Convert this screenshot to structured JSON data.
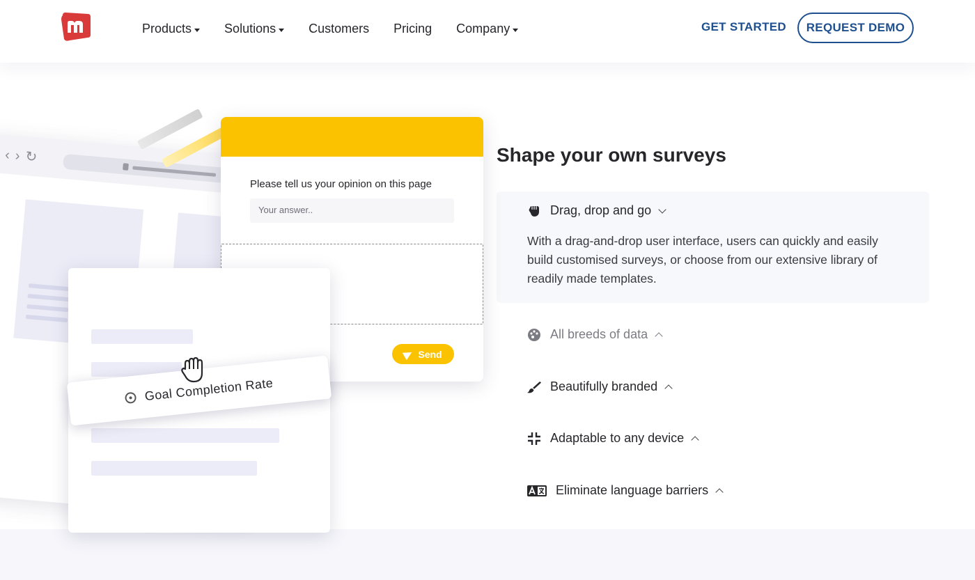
{
  "header": {
    "logo_icon": "m-logo-icon",
    "nav": [
      {
        "label": "Products",
        "has_dropdown": true
      },
      {
        "label": "Solutions",
        "has_dropdown": true
      },
      {
        "label": "Customers",
        "has_dropdown": false
      },
      {
        "label": "Pricing",
        "has_dropdown": false
      },
      {
        "label": "Company",
        "has_dropdown": true
      }
    ],
    "get_started": "GET STARTED",
    "request_demo": "REQUEST DEMO"
  },
  "illustration": {
    "survey_question": "Please tell us your opinion on this page",
    "survey_placeholder": "Your answer..",
    "send_label": "Send",
    "goal_label": "Goal Completion Rate"
  },
  "features": {
    "headline": "Shape your own surveys",
    "items": [
      {
        "label": "Drag, drop and go",
        "icon": "fist-icon",
        "expanded": true,
        "description": "With a drag-and-drop user interface, users can quickly and easily build customised surveys, or choose from our extensive library of readily made templates."
      },
      {
        "label": "All breeds of data",
        "icon": "palette-icon",
        "expanded": false
      },
      {
        "label": "Beautifully branded",
        "icon": "brush-icon",
        "expanded": false
      },
      {
        "label": "Adaptable to any device",
        "icon": "compress-icon",
        "expanded": false
      },
      {
        "label": "Eliminate language barriers",
        "icon": "translate-icon",
        "expanded": false
      }
    ]
  },
  "colors": {
    "brand_red": "#d93a3a",
    "brand_blue": "#1e4f8f",
    "accent_yellow": "#fbc200"
  }
}
